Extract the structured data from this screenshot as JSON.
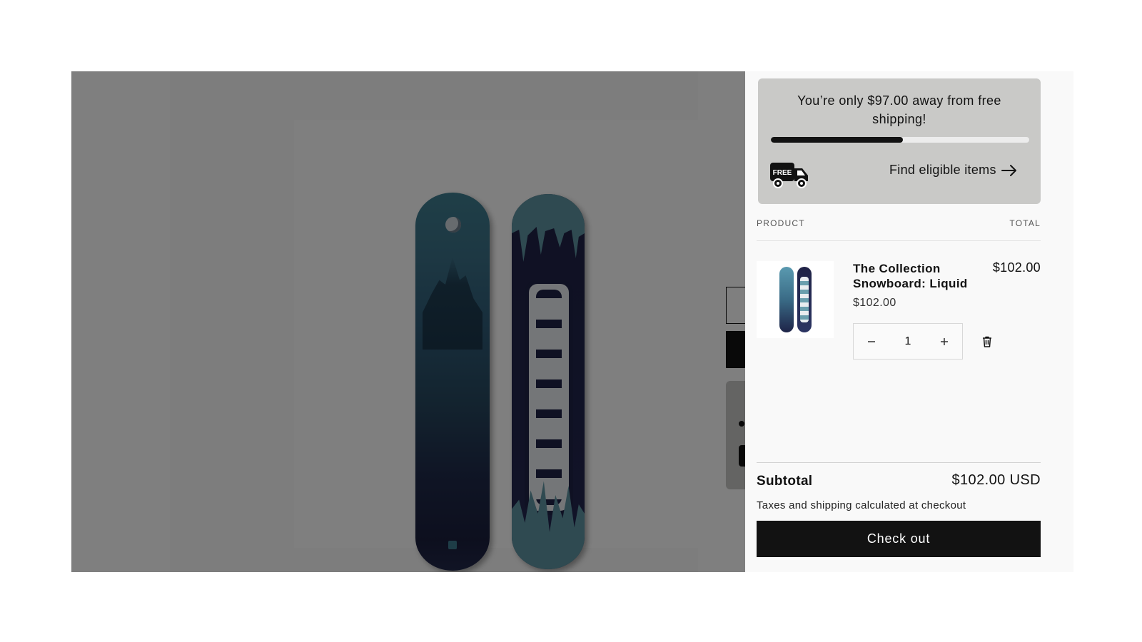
{
  "cart": {
    "shipping_message": "You’re only $97.00 away from free shipping!",
    "shipping_progress_fraction": 0.51,
    "free_badge_label": "FREE",
    "find_items_label": "Find eligible items",
    "columns": {
      "product": "PRODUCT",
      "total": "TOTAL"
    },
    "item": {
      "name": "The Collection Snowboard: Liquid",
      "unit_price": "$102.00",
      "line_total": "$102.00",
      "quantity": "1"
    },
    "qty_minus_icon": "minus-icon",
    "qty_plus_icon": "plus-icon",
    "remove_icon": "trash-icon",
    "subtotal_label": "Subtotal",
    "subtotal_value": "$102.00 USD",
    "tax_note": "Taxes and shipping calculated at checkout",
    "checkout_label": "Check out"
  },
  "colors": {
    "overlay": "rgba(0,0,0,0.5)",
    "drawer_bg": "#f9f9f9",
    "card_bg": "#c9c9c7",
    "primary": "#121212"
  }
}
